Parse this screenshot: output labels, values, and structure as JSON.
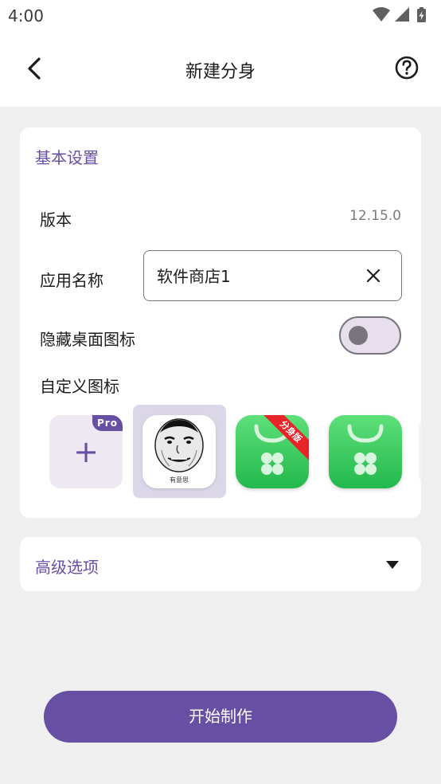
{
  "status_bar": {
    "time": "4:00"
  },
  "app_bar": {
    "title": "新建分身"
  },
  "basic_settings": {
    "title": "基本设置",
    "version_label": "版本",
    "version_value": "12.15.0",
    "app_name_label": "应用名称",
    "app_name_value": "软件商店1",
    "hide_icon_label": "隐藏桌面图标",
    "hide_icon_enabled": false,
    "custom_icon_label": "自定义图标",
    "icons": {
      "add_badge": "Pro",
      "add_symbol": "+",
      "meme_caption": "有意思",
      "ribbon_text": "分身版"
    }
  },
  "advanced": {
    "title": "高级选项"
  },
  "start_button": {
    "label": "开始制作"
  },
  "colors": {
    "accent": "#6750a4",
    "background": "#efefef",
    "card": "#ffffff",
    "green_icon": "#34c759",
    "ribbon": "#e8232a"
  }
}
